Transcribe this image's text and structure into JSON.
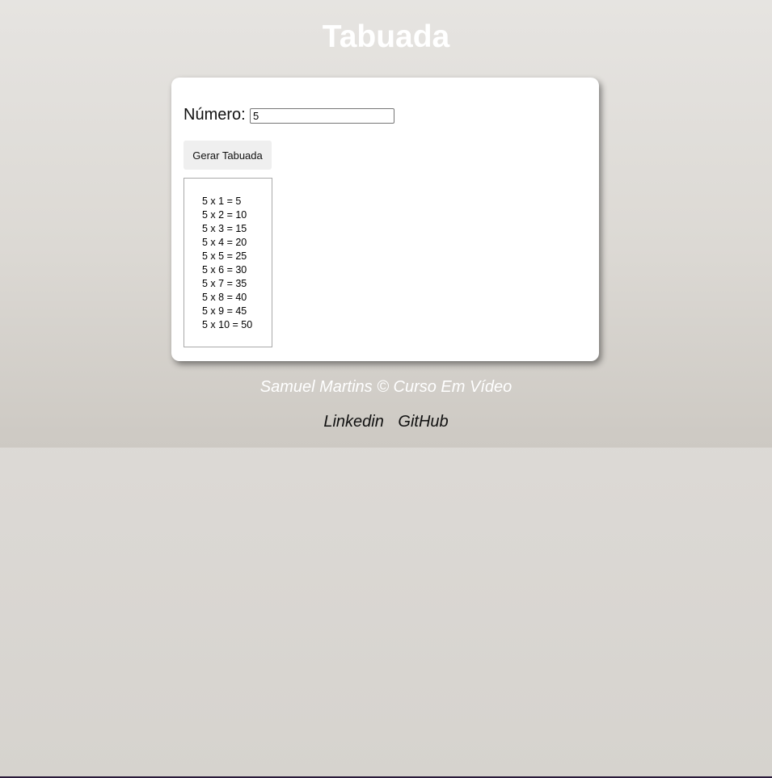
{
  "header": {
    "title": "Tabuada"
  },
  "form": {
    "label": "Número:",
    "input_value": "5",
    "button_label": "Gerar Tabuada"
  },
  "results": [
    "5 x 1 = 5",
    "5 x 2 = 10",
    "5 x 3 = 15",
    "5 x 4 = 20",
    "5 x 5 = 25",
    "5 x 6 = 30",
    "5 x 7 = 35",
    "5 x 8 = 40",
    "5 x 9 = 45",
    "5 x 10 = 50"
  ],
  "footer": {
    "credit": "Samuel Martins © Curso Em Vídeo",
    "links": [
      {
        "label": "Linkedin"
      },
      {
        "label": "GitHub"
      }
    ]
  },
  "colors": {
    "card_background": "#ffffff",
    "title_color": "#ffffff",
    "button_background": "#efefef"
  }
}
